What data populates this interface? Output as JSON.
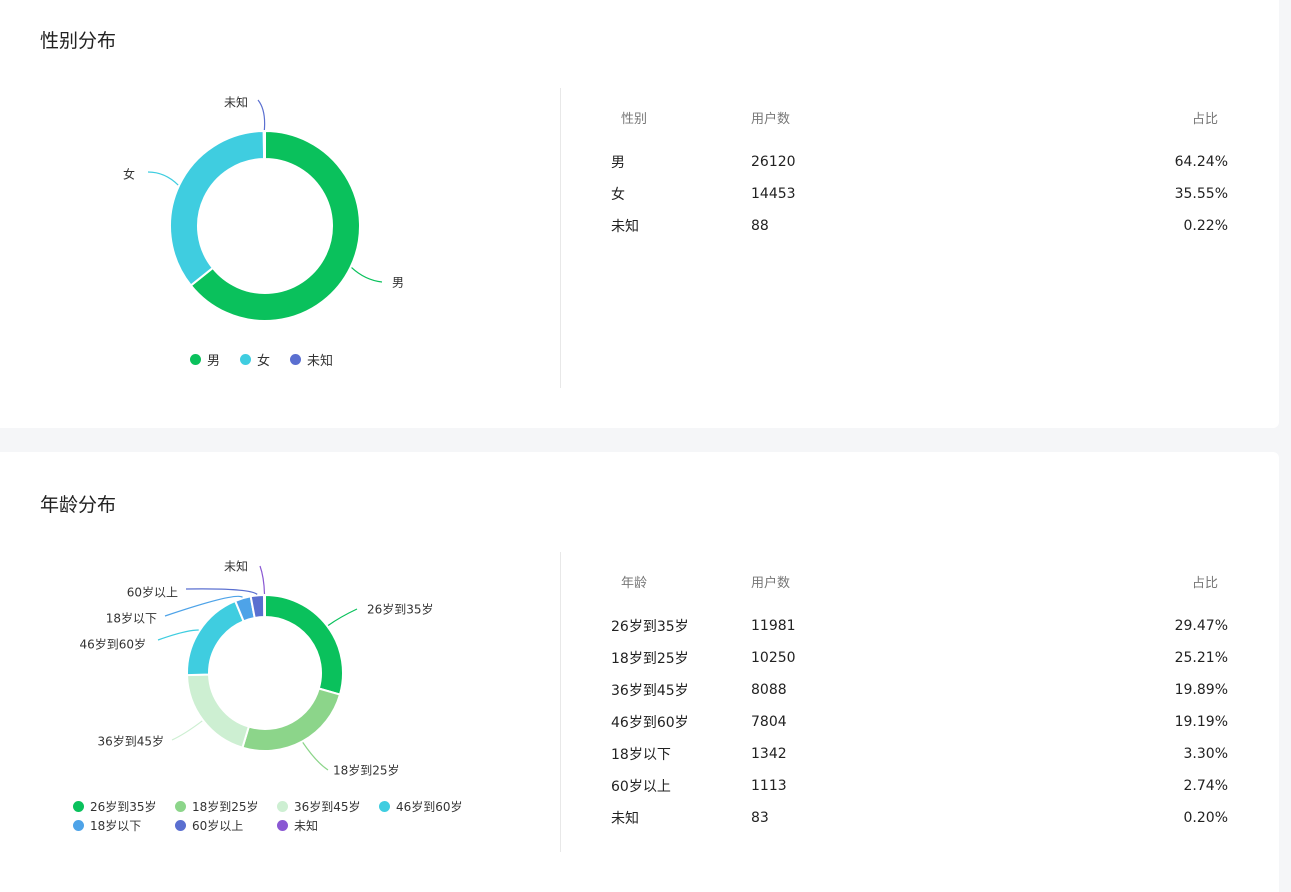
{
  "sections": {
    "gender": {
      "title": "性别分布",
      "table_headers": [
        "性别",
        "用户数",
        "占比"
      ],
      "rows": [
        {
          "label": "男",
          "count": "26120",
          "share": "64.24%"
        },
        {
          "label": "女",
          "count": "14453",
          "share": "35.55%"
        },
        {
          "label": "未知",
          "count": "88",
          "share": "0.22%"
        }
      ]
    },
    "age": {
      "title": "年龄分布",
      "table_headers": [
        "年龄",
        "用户数",
        "占比"
      ],
      "rows": [
        {
          "label": "26岁到35岁",
          "count": "11981",
          "share": "29.47%"
        },
        {
          "label": "18岁到25岁",
          "count": "10250",
          "share": "25.21%"
        },
        {
          "label": "36岁到45岁",
          "count": "8088",
          "share": "19.89%"
        },
        {
          "label": "46岁到60岁",
          "count": "7804",
          "share": "19.19%"
        },
        {
          "label": "18岁以下",
          "count": "1342",
          "share": "3.30%"
        },
        {
          "label": "60岁以上",
          "count": "1113",
          "share": "2.74%"
        },
        {
          "label": "未知",
          "count": "83",
          "share": "0.20%"
        }
      ]
    }
  },
  "chart_data": [
    {
      "type": "pie",
      "donut": true,
      "title": "",
      "legend_position": "bottom",
      "categories": [
        "男",
        "女",
        "未知"
      ],
      "values": [
        26120,
        14453,
        88
      ],
      "colors": [
        "#0ac15c",
        "#3fcde0",
        "#5a6fd0"
      ]
    },
    {
      "type": "pie",
      "donut": true,
      "title": "",
      "legend_position": "bottom",
      "categories": [
        "26岁到35岁",
        "18岁到25岁",
        "36岁到45岁",
        "46岁到60岁",
        "18岁以下",
        "60岁以上",
        "未知"
      ],
      "values": [
        11981,
        10250,
        8088,
        7804,
        1342,
        1113,
        83
      ],
      "colors": [
        "#0ac15c",
        "#8cd58a",
        "#cdefd2",
        "#3fcde0",
        "#4ea3e8",
        "#5a6fd0",
        "#8a58d3"
      ]
    }
  ]
}
